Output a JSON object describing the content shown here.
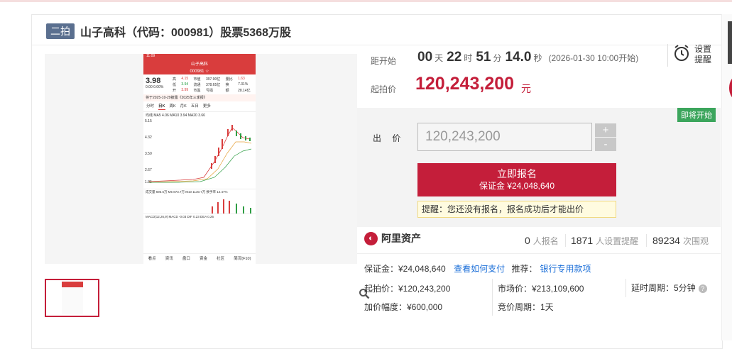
{
  "header": {
    "tag": "二拍",
    "title": "山子高科（代码：000981）股票5368万股"
  },
  "countdown": {
    "label": "距开始",
    "days": "00",
    "days_unit": "天",
    "hours": "22",
    "hours_unit": "时",
    "minutes": "51",
    "minutes_unit": "分",
    "seconds": "14.0",
    "seconds_unit": "秒",
    "start_time": "(2026-01-30 10:00开始)"
  },
  "remind": {
    "line1": "设置",
    "line2": "提醒"
  },
  "start_price": {
    "label": "起拍价",
    "value": "120,243,200",
    "unit": "元"
  },
  "badge": "即将开始",
  "bid": {
    "label": "出 价",
    "value": "120,243,200",
    "plus": "+",
    "minus": "-",
    "signup_label": "立即报名",
    "deposit_line": "保证金 ¥24,048,640",
    "tip": "提醒：您还没有报名，报名成功后才能出价"
  },
  "platform": {
    "name": "阿里资产"
  },
  "stats": {
    "signups": "0",
    "signups_label": "人报名",
    "reminders": "1871",
    "reminders_label": "人设置提醒",
    "watchers": "89234",
    "watchers_label": "次围观"
  },
  "details": {
    "deposit": "保证金：¥24,048,640",
    "how_to_pay": "查看如何支付",
    "recommend_label": "推荐：",
    "recommend_link": "银行专用款项",
    "start_price": "起拍价：¥120,243,200",
    "market_price": "市场价：¥213,109,600",
    "delay_period": "延时周期：5分钟",
    "increment": "加价幅度：¥600,000",
    "bid_period": "竞价周期：1天"
  },
  "phone": {
    "status": "11:09",
    "name": "山子高科",
    "code": "000981 ☆",
    "price": "3.98",
    "change": "0.00  0.00%",
    "cells": [
      "高",
      "4.15",
      "市值",
      "397.90亿",
      "量比",
      "1.63",
      "低",
      "3.94",
      "流通",
      "378.65亿",
      "换",
      "7.31%",
      "开",
      "3.99",
      "市盈",
      "亏损",
      "额",
      "28.14亿"
    ],
    "banner": "将于2025-10-29披露《2025年三季报》",
    "tabs": [
      "分时",
      "日K",
      "周K",
      "月K",
      "五日",
      "更多"
    ],
    "ma_line": "均线  MA5 4.06  MA10 3.94  MA20 3.66",
    "axis": [
      "5.15",
      "4.32",
      "3.50",
      "2.67",
      "1.85"
    ],
    "dates": [
      "2025-08-04",
      "09-29",
      "10-27"
    ],
    "vol_label": "成交量  695.6万  M5 873.7万  M10 1130.7万  换手率 12.47%",
    "macd_label": "MACD(12,26,9)  MACD -0.03  DIF 0.23  DEA 0.26",
    "bottom_tabs": [
      "看点",
      "资讯",
      "盘口",
      "资金",
      "社区",
      "简况(F10)"
    ]
  },
  "colors": {
    "accent": "#c41e3a",
    "tag_bg": "#5a6f8f",
    "link": "#1a6ed8",
    "badge": "#3ba55c"
  }
}
